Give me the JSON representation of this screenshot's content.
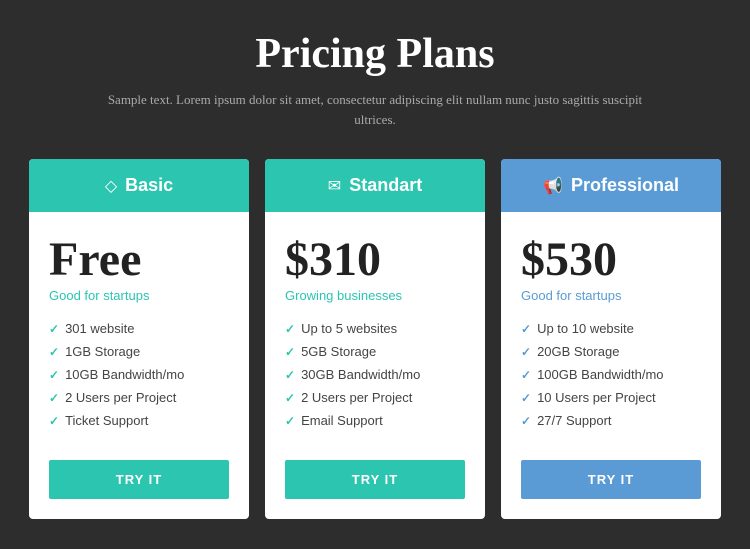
{
  "page": {
    "title": "Pricing Plans",
    "subtitle": "Sample text. Lorem ipsum dolor sit amet, consectetur adipiscing elit nullam nunc justo sagittis suscipit ultrices."
  },
  "plans": [
    {
      "id": "basic",
      "header_class": "basic",
      "card_class": "basic",
      "icon": "◇",
      "name": "Basic",
      "price": "Free",
      "tagline": "Good for startups",
      "tagline_class": "teal",
      "features": [
        "301 website",
        "1GB Storage",
        "10GB Bandwidth/mo",
        "2 Users per Project",
        "Ticket Support"
      ],
      "button_label": "TRY IT",
      "button_class": "teal"
    },
    {
      "id": "standart",
      "header_class": "standart",
      "card_class": "standart",
      "icon": "✉",
      "name": "Standart",
      "price": "$310",
      "tagline": "Growing businesses",
      "tagline_class": "teal",
      "features": [
        "Up to 5 websites",
        "5GB Storage",
        "30GB Bandwidth/mo",
        "2 Users per Project",
        "Email Support"
      ],
      "button_label": "TRY IT",
      "button_class": "teal"
    },
    {
      "id": "professional",
      "header_class": "professional",
      "card_class": "professional",
      "icon": "📢",
      "name": "Professional",
      "price": "$530",
      "tagline": "Good for startups",
      "tagline_class": "blue",
      "features": [
        "Up to 10 website",
        "20GB Storage",
        "100GB Bandwidth/mo",
        "10 Users per Project",
        "27/7 Support"
      ],
      "button_label": "TRY IT",
      "button_class": "blue"
    }
  ]
}
